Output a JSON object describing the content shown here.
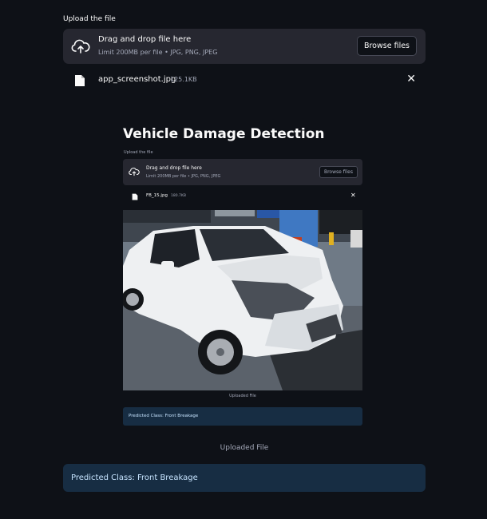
{
  "upload": {
    "label": "Upload the file",
    "dropzone_title": "Drag and drop file here",
    "dropzone_limit": "Limit 200MB per file • JPG, PNG, JPEG",
    "browse_label": "Browse files",
    "file_name": "app_screenshot.jpg",
    "file_size": "125.1KB",
    "remove_symbol": "✕"
  },
  "screenshot": {
    "title": "Vehicle Damage Detection",
    "upload_label": "Upload the file",
    "dropzone_title": "Drag and drop file here",
    "dropzone_limit": "Limit 200MB per file • JPG, PNG, JPEG",
    "browse_label": "Browse files",
    "file_name": "FB_15.jpg",
    "file_size": "180.7KB",
    "remove_symbol": "✕",
    "image_caption": "Uploaded File",
    "prediction": "Predicted Class: Front Breakage"
  },
  "image_caption": "Uploaded File",
  "prediction": "Predicted Class: Front Breakage",
  "colors": {
    "background": "#0e1117",
    "panel": "#262730",
    "info_bg": "#172d43",
    "info_text": "#c7e4ff"
  },
  "icons": {
    "upload": "cloud-upload-icon",
    "file": "file-icon",
    "close": "close-icon"
  }
}
